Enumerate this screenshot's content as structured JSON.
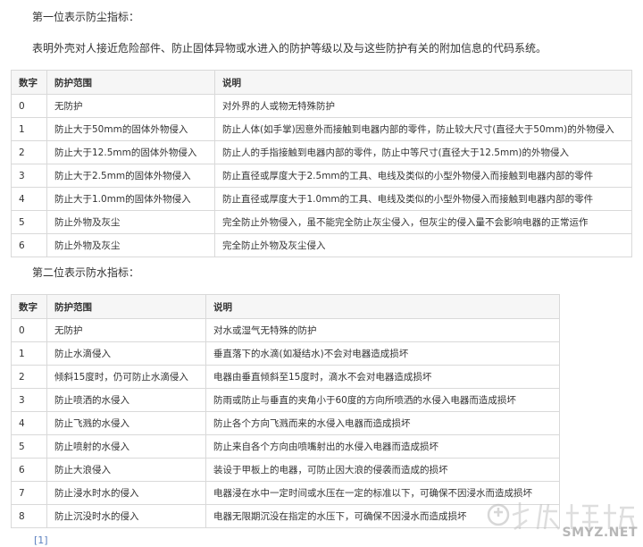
{
  "dust": {
    "heading": "第一位表示防尘指标：",
    "intro": "表明外壳对人接近危险部件、防止固体异物或水进入的防护等级以及与这些防护有关的附加信息的代码系统。",
    "columns": [
      "数字",
      "防护范围",
      "说明"
    ],
    "rows": [
      [
        "0",
        "无防护",
        "对外界的人或物无特殊防护"
      ],
      [
        "1",
        "防止大于50mm的固体外物侵入",
        "防止人体(如手掌)因意外而接触到电器内部的零件，防止较大尺寸(直径大于50mm)的外物侵入"
      ],
      [
        "2",
        "防止大于12.5mm的固体外物侵入",
        "防止人的手指接触到电器内部的零件，防止中等尺寸(直径大于12.5mm)的外物侵入"
      ],
      [
        "3",
        "防止大于2.5mm的固体外物侵入",
        "防止直径或厚度大于2.5mm的工具、电线及类似的小型外物侵入而接触到电器内部的零件"
      ],
      [
        "4",
        "防止大于1.0mm的固体外物侵入",
        "防止直径或厚度大于1.0mm的工具、电线及类似的小型外物侵入而接触到电器内部的零件"
      ],
      [
        "5",
        "防止外物及灰尘",
        "完全防止外物侵入，虽不能完全防止灰尘侵入，但灰尘的侵入量不会影响电器的正常运作"
      ],
      [
        "6",
        "防止外物及灰尘",
        "完全防止外物及灰尘侵入"
      ]
    ]
  },
  "water": {
    "heading": "第二位表示防水指标：",
    "columns": [
      "数字",
      "防护范围",
      "说明"
    ],
    "rows": [
      [
        "0",
        "无防护",
        "对水或湿气无特殊的防护"
      ],
      [
        "1",
        "防止水滴侵入",
        "垂直落下的水滴(如凝结水)不会对电器造成损坏"
      ],
      [
        "2",
        "倾斜15度时，仍可防止水滴侵入",
        "电器由垂直倾斜至15度时，滴水不会对电器造成损坏"
      ],
      [
        "3",
        "防止喷洒的水侵入",
        "防雨或防止与垂直的夹角小于60度的方向所喷洒的水侵入电器而造成损坏"
      ],
      [
        "4",
        "防止飞溅的水侵入",
        "防止各个方向飞溅而来的水侵入电器而造成损坏"
      ],
      [
        "5",
        "防止喷射的水侵入",
        "防止来自各个方向由喷嘴射出的水侵入电器而造成损坏"
      ],
      [
        "6",
        "防止大浪侵入",
        "装设于甲板上的电器，可防止因大浪的侵袭而造成的损坏"
      ],
      [
        "7",
        "防止浸水时水的侵入",
        "电器浸在水中一定时间或水压在一定的标准以下，可确保不因浸水而造成损坏"
      ],
      [
        "8",
        "防止沉没时水的侵入",
        "电器无限期沉没在指定的水压下，可确保不因浸水而造成损坏"
      ]
    ]
  },
  "reference": "[1]",
  "watermark": {
    "icon": "zhi-watermark-icon",
    "text": "SMYZ.NET",
    "color": "#b7b7b7"
  }
}
